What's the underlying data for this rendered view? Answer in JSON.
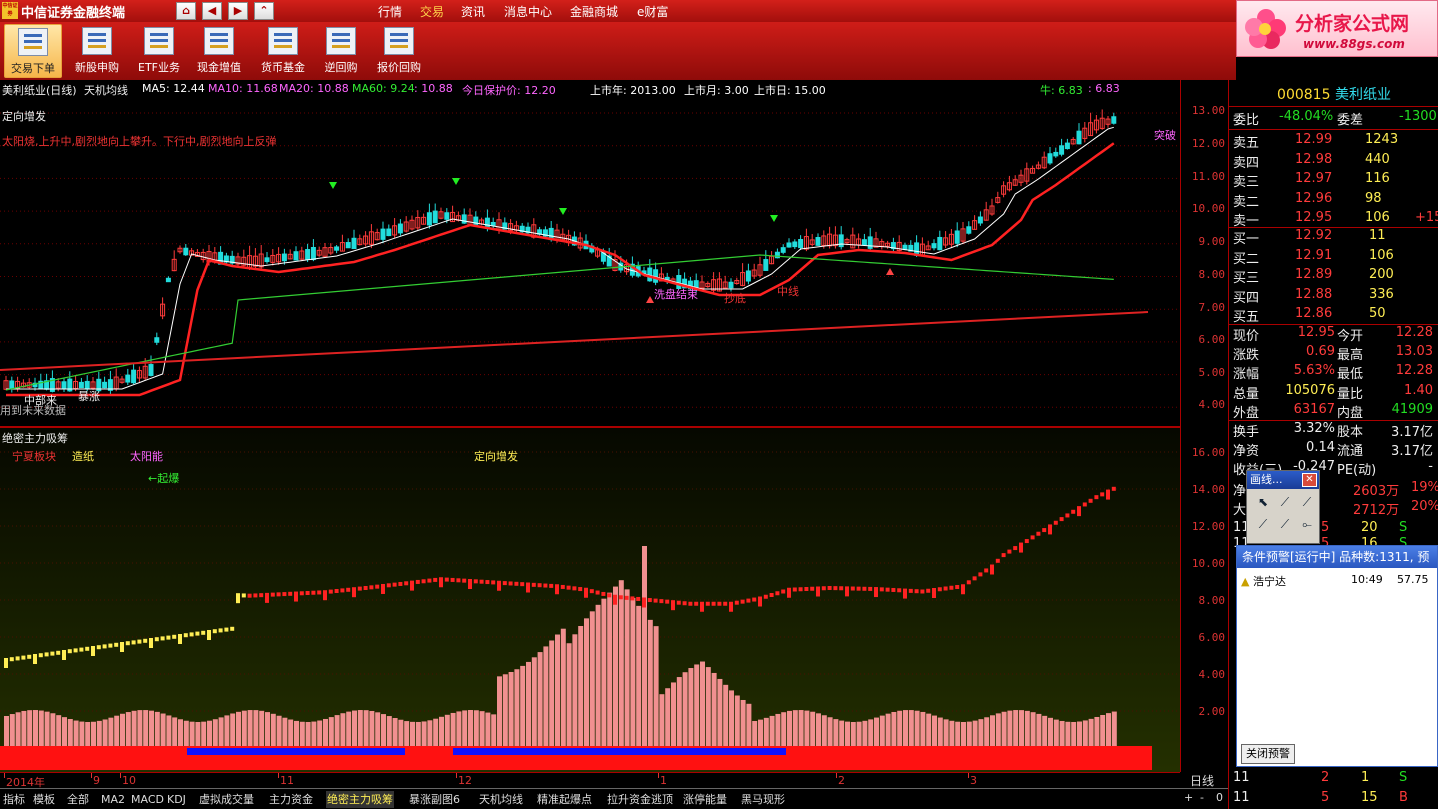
{
  "titlebar": {
    "logo_text": "中信证券",
    "app_title": "中信证券金融终端",
    "nav": [
      "⌂",
      "◀",
      "▶",
      "⌃"
    ],
    "menu": [
      {
        "label": "行情",
        "active": false
      },
      {
        "label": "交易",
        "active": true
      },
      {
        "label": "资讯",
        "active": false
      },
      {
        "label": "消息中心",
        "active": false
      },
      {
        "label": "金融商城",
        "active": false
      },
      {
        "label": "e财富",
        "active": false
      }
    ]
  },
  "brand": {
    "title": "分析家公式网",
    "url": "www.88gs.com"
  },
  "toolbar": [
    {
      "label": "交易下单",
      "icon": "trade-order-icon",
      "active": true
    },
    {
      "label": "新股申购",
      "icon": "ipo-icon",
      "active": false
    },
    {
      "label": "ETF业务",
      "icon": "etf-icon",
      "active": false
    },
    {
      "label": "现金增值",
      "icon": "cash-icon",
      "active": false
    },
    {
      "label": "货币基金",
      "icon": "fund-icon",
      "active": false
    },
    {
      "label": "逆回购",
      "icon": "repo-icon",
      "active": false
    },
    {
      "label": "报价回购",
      "icon": "quote-repo-icon",
      "active": false
    }
  ],
  "legend": {
    "stock": "美利纸业(日线)",
    "indicator": "天机均线",
    "ma5": "MA5: 12.44",
    "ma10": "MA10: 11.68",
    "ma20": "MA20: 10.88",
    "ma60": "MA60: 9.24",
    "extra": ": 10.88",
    "protect": "今日保护价: 12.20",
    "year": "上市年: 2013.00",
    "month": "上市月: 3.00",
    "day": "上市日: 15.00",
    "bull": "牛: 6.83",
    "bull2": ": 6.83",
    "colors": {
      "ma5": "#ffffff",
      "ma10": "#ff66ff",
      "ma20": "#ff66ff",
      "ma60": "#33ee33",
      "protect": "#ff66ff"
    }
  },
  "main_chart": {
    "labels": {
      "top_left": "定向增发",
      "note": "太阳烧,上升中,剧烈地向上攀升。下行中,剧烈地向上反弹",
      "breakout": "突破",
      "washout": "洗盘结束",
      "bottom": "抄底",
      "mid": "中线",
      "surge": "暴涨",
      "center": "中部来",
      "future": "用到未来数据"
    },
    "y_ticks": [
      "13.00",
      "12.00",
      "11.00",
      "10.00",
      "9.00",
      "8.00",
      "7.00",
      "6.00",
      "5.00",
      "4.00"
    ]
  },
  "sub_chart": {
    "title": "绝密主力吸筹",
    "labels": {
      "a": "宁夏板块",
      "b": "造纸",
      "c": "太阳能",
      "d": "←起爆",
      "e": "定向增发"
    },
    "y_ticks": [
      "16.00",
      "14.00",
      "12.00",
      "10.00",
      "8.00",
      "6.00",
      "4.00",
      "2.00"
    ]
  },
  "date_axis": {
    "labels": [
      {
        "t": "2014年",
        "x": 4
      },
      {
        "t": "9",
        "x": 91
      },
      {
        "t": "10",
        "x": 120
      },
      {
        "t": "11",
        "x": 278
      },
      {
        "t": "12",
        "x": 456
      },
      {
        "t": "1",
        "x": 658
      },
      {
        "t": "2",
        "x": 836
      },
      {
        "t": "3",
        "x": 968
      }
    ],
    "period": "日线"
  },
  "tabs": [
    "指标",
    "模板",
    "全部",
    "MA2",
    "MACD",
    "KDJ",
    "虚拟成交量",
    "主力资金",
    "绝密主力吸筹",
    "暴涨副图6",
    "天机均线",
    "精准起爆点",
    "拉升资金逃顶",
    "涨停能量",
    "黑马现形"
  ],
  "tabs_active": "绝密主力吸筹",
  "tab_controls": [
    "+",
    "-",
    "0"
  ],
  "quote": {
    "code": "000815",
    "name": "美利纸业",
    "weibi_label": "委比",
    "weibi": "-48.04%",
    "weicha_label": "委差",
    "weicha": "-1300",
    "sells": [
      {
        "label": "卖五",
        "price": "12.99",
        "vol": "1243",
        "chg": ""
      },
      {
        "label": "卖四",
        "price": "12.98",
        "vol": "440",
        "chg": ""
      },
      {
        "label": "卖三",
        "price": "12.97",
        "vol": "116",
        "chg": ""
      },
      {
        "label": "卖二",
        "price": "12.96",
        "vol": "98",
        "chg": ""
      },
      {
        "label": "卖一",
        "price": "12.95",
        "vol": "106",
        "chg": "+15"
      }
    ],
    "buys": [
      {
        "label": "买一",
        "price": "12.92",
        "vol": "11"
      },
      {
        "label": "买二",
        "price": "12.91",
        "vol": "106"
      },
      {
        "label": "买三",
        "price": "12.89",
        "vol": "200"
      },
      {
        "label": "买四",
        "price": "12.88",
        "vol": "336"
      },
      {
        "label": "买五",
        "price": "12.86",
        "vol": "50"
      }
    ],
    "stats": [
      {
        "l1": "现价",
        "v1": "12.95",
        "c1": "red",
        "l2": "今开",
        "v2": "12.28",
        "c2": "red"
      },
      {
        "l1": "涨跌",
        "v1": "0.69",
        "c1": "red",
        "l2": "最高",
        "v2": "13.03",
        "c2": "red"
      },
      {
        "l1": "涨幅",
        "v1": "5.63%",
        "c1": "red",
        "l2": "最低",
        "v2": "12.28",
        "c2": "red"
      },
      {
        "l1": "总量",
        "v1": "105076",
        "c1": "yel",
        "l2": "量比",
        "v2": "1.40",
        "c2": "red"
      },
      {
        "l1": "外盘",
        "v1": "63167",
        "c1": "red",
        "l2": "内盘",
        "v2": "41909",
        "c2": "green"
      }
    ],
    "stats2": [
      {
        "l1": "换手",
        "v1": "3.32%",
        "c1": "wht",
        "l2": "股本",
        "v2": "3.17亿",
        "c2": "wht"
      },
      {
        "l1": "净资",
        "v1": "0.14",
        "c1": "wht",
        "l2": "流通",
        "v2": "3.17亿",
        "c2": "wht"
      },
      {
        "l1": "收益(三)",
        "v1": "-0.247",
        "c1": "wht",
        "l2": "PE(动)",
        "v2": "-",
        "c2": "wht"
      }
    ],
    "flow": [
      {
        "l": "净",
        "v": "2603万",
        "p": "19%"
      },
      {
        "l": "大",
        "v": "2712万",
        "p": "20%"
      }
    ],
    "ticks": [
      {
        "t": "11",
        "v": "5",
        "n": "20",
        "s": "S"
      },
      {
        "t": "11",
        "v": "5",
        "n": "16",
        "s": "S"
      },
      {
        "t": "11",
        "v": "2",
        "n": "1",
        "s": "S"
      },
      {
        "t": "11",
        "v": "5",
        "n": "15",
        "s": "B"
      }
    ]
  },
  "draw_panel": {
    "title": "画线...",
    "close": "✕",
    "tools": [
      "⬉",
      "⟋",
      "⟋",
      "⟋",
      "⟋",
      "⟜"
    ]
  },
  "alert_window": {
    "title": "条件预警[运行中] 品种数:1311, 预",
    "row": {
      "name": "浩宁达",
      "time": "10:49",
      "price": "57.75"
    },
    "button": "关闭预警"
  }
}
